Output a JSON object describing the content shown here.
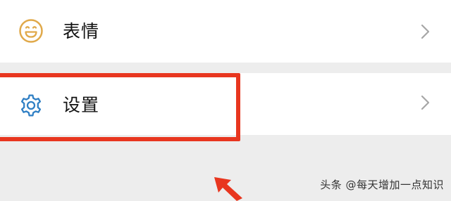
{
  "menu": {
    "items": [
      {
        "label": "表情",
        "icon": "smiley-face-icon"
      },
      {
        "label": "设置",
        "icon": "settings-gear-icon"
      }
    ]
  },
  "colors": {
    "emoji_icon": "#e0a94a",
    "settings_icon": "#2f7fc4",
    "highlight": "#e8361f",
    "chevron": "#a6a6a6"
  },
  "watermark": {
    "text": "头条 @每天增加一点知识"
  }
}
